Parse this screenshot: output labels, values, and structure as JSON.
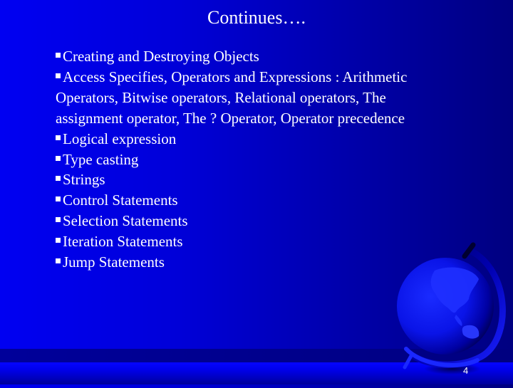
{
  "slide": {
    "title": "Continues….",
    "bullet_icon": "square-bullet-icon",
    "items": [
      {
        "text": "Creating and Destroying Objects",
        "bullet": true
      },
      {
        "text": "Access Specifies, Operators and Expressions : Arithmetic",
        "bullet": true
      },
      {
        "text": "Operators, Bitwise operators, Relational operators, The",
        "bullet": false
      },
      {
        "text": "assignment operator, The ? Operator, Operator precedence",
        "bullet": false
      },
      {
        "text": "Logical expression",
        "bullet": true
      },
      {
        "text": "Type casting",
        "bullet": true
      },
      {
        "text": "Strings",
        "bullet": true
      },
      {
        "text": "Control Statements",
        "bullet": true
      },
      {
        "text": "Selection Statements",
        "bullet": true
      },
      {
        "text": "Iteration Statements",
        "bullet": true
      },
      {
        "text": "Jump Statements",
        "bullet": true
      }
    ],
    "page_number": "4",
    "decoration_icon": "globe-icon",
    "colors": {
      "background_light": "#0000f2",
      "background_dark": "#000080",
      "text": "#ffffff",
      "bar": "#0505ff"
    }
  }
}
